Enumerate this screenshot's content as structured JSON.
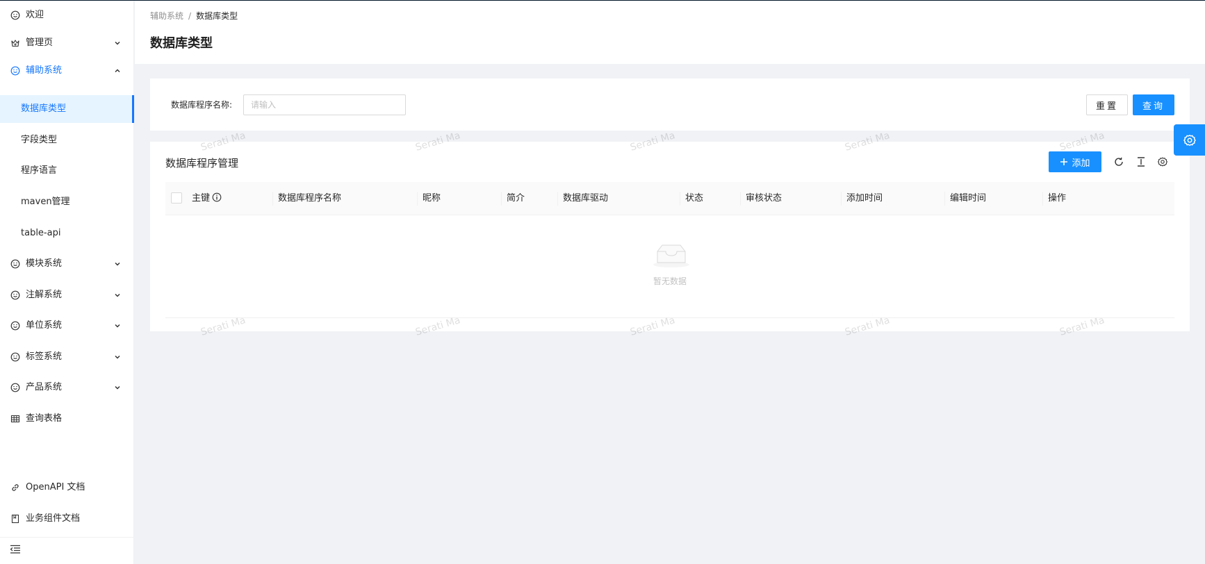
{
  "sidebar": {
    "items": [
      {
        "label": "欢迎",
        "icon": "smile-icon"
      },
      {
        "label": "管理页",
        "icon": "crown-icon",
        "arrow": "down"
      },
      {
        "label": "辅助系统",
        "icon": "smile-icon",
        "arrow": "up"
      },
      {
        "label": "数据库类型",
        "sub": true,
        "active": true
      },
      {
        "label": "字段类型",
        "sub": true
      },
      {
        "label": "程序语言",
        "sub": true
      },
      {
        "label": "maven管理",
        "sub": true
      },
      {
        "label": "table-api",
        "sub": true
      },
      {
        "label": "模块系统",
        "icon": "smile-icon",
        "arrow": "down"
      },
      {
        "label": "注解系统",
        "icon": "smile-icon",
        "arrow": "down"
      },
      {
        "label": "单位系统",
        "icon": "smile-icon",
        "arrow": "down"
      },
      {
        "label": "标签系统",
        "icon": "smile-icon",
        "arrow": "down"
      },
      {
        "label": "产品系统",
        "icon": "smile-icon",
        "arrow": "down"
      },
      {
        "label": "查询表格",
        "icon": "table-icon"
      }
    ],
    "bottom": [
      {
        "label": "OpenAPI 文档",
        "icon": "link-icon"
      },
      {
        "label": "业务组件文档",
        "icon": "book-icon"
      }
    ]
  },
  "header": {
    "breadcrumb": [
      "辅助系统",
      "/",
      "数据库类型"
    ],
    "title": "数据库类型"
  },
  "search": {
    "label": "数据库程序名称:",
    "value": "",
    "placeholder": "请输入",
    "reset_label": "重置",
    "query_label": "查询"
  },
  "table": {
    "title": "数据库程序管理",
    "add_label": "添加",
    "columns": [
      "主键",
      "数据库程序名称",
      "昵称",
      "简介",
      "数据库驱动",
      "状态",
      "审核状态",
      "添加时间",
      "编辑时间",
      "操作"
    ],
    "rows": [],
    "empty_text": "暂无数据"
  },
  "watermark": "Serati Ma",
  "colors": {
    "primary": "#1890ff",
    "active_bg": "#e6f4ff",
    "page_bg": "#f0f2f5"
  }
}
